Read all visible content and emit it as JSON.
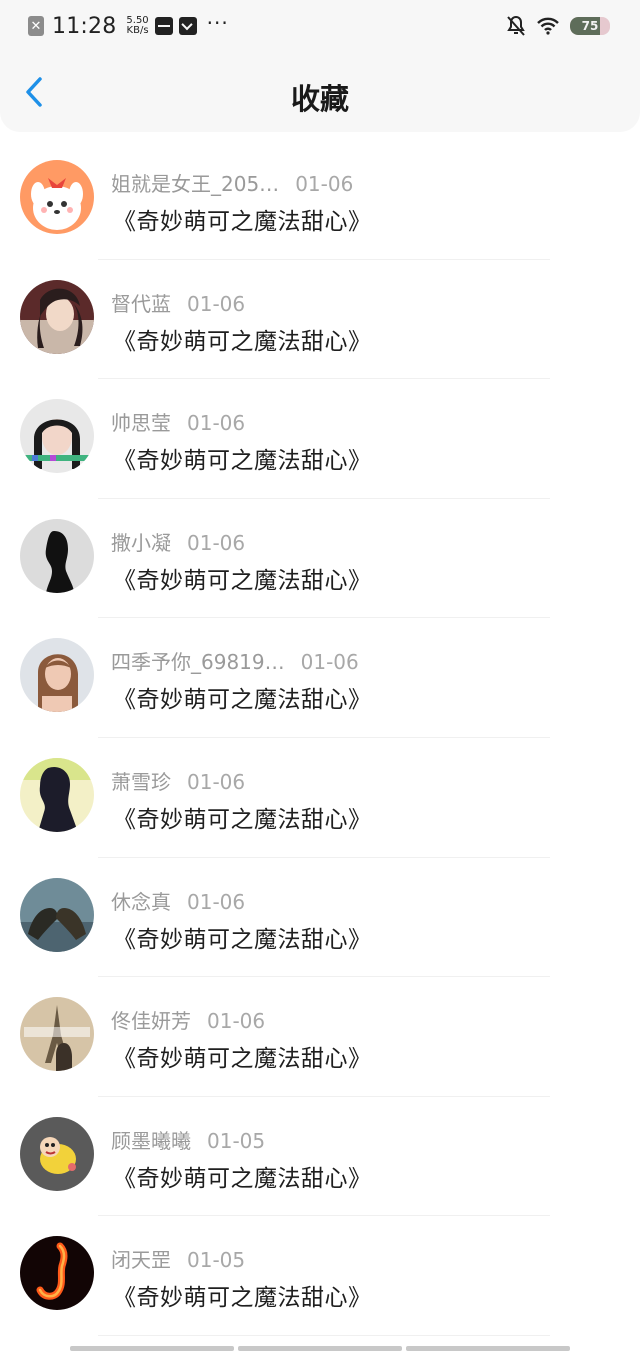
{
  "status_bar": {
    "app_icon": "close-square-icon",
    "time": "11:28",
    "speed_value": "5.50",
    "speed_unit": "KB/s",
    "more": "···",
    "battery": "75",
    "battery_level": 0.75
  },
  "header": {
    "back_icon": "chevron-left-icon",
    "title": "收藏",
    "accent": "#1e90e8"
  },
  "favorites": [
    {
      "name": "姐就是女王_205…",
      "date": "01-06",
      "title": "《奇妙萌可之魔法甜心》",
      "truncated": true
    },
    {
      "name": "督代蓝",
      "date": "01-06",
      "title": "《奇妙萌可之魔法甜心》"
    },
    {
      "name": "帅思莹",
      "date": "01-06",
      "title": "《奇妙萌可之魔法甜心》"
    },
    {
      "name": "撒小凝",
      "date": "01-06",
      "title": "《奇妙萌可之魔法甜心》"
    },
    {
      "name": "四季予你_69819…",
      "date": "01-06",
      "title": "《奇妙萌可之魔法甜心》",
      "truncated": true
    },
    {
      "name": "萧雪珍",
      "date": "01-06",
      "title": "《奇妙萌可之魔法甜心》"
    },
    {
      "name": "休念真",
      "date": "01-06",
      "title": "《奇妙萌可之魔法甜心》"
    },
    {
      "name": "佟佳妍芳",
      "date": "01-06",
      "title": "《奇妙萌可之魔法甜心》"
    },
    {
      "name": "顾墨曦曦",
      "date": "01-05",
      "title": "《奇妙萌可之魔法甜心》"
    },
    {
      "name": "闭天罡",
      "date": "01-05",
      "title": "《奇妙萌可之魔法甜心》"
    }
  ]
}
